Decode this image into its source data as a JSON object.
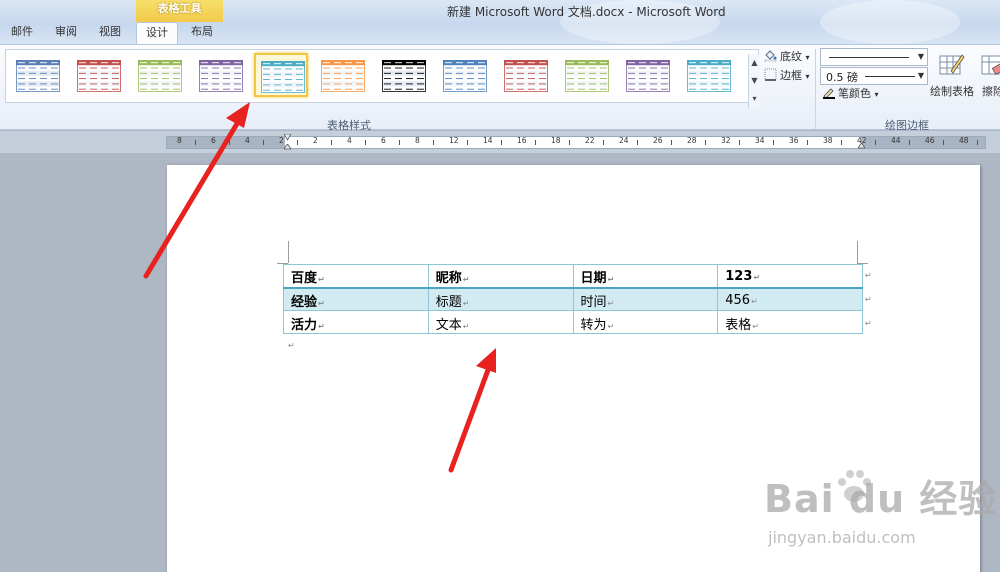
{
  "window": {
    "title": "新建 Microsoft Word 文档.docx  -  Microsoft Word"
  },
  "context_tab_header": "表格工具",
  "tabs": [
    {
      "label": "邮件",
      "active": false
    },
    {
      "label": "审阅",
      "active": false
    },
    {
      "label": "视图",
      "active": false
    },
    {
      "label": "设计",
      "active": true
    },
    {
      "label": "布局",
      "active": false
    }
  ],
  "table_styles": {
    "group_label": "表格样式",
    "selected_index": 4,
    "swatch_colors": [
      "#5b7fb5",
      "#c0504d",
      "#9bbb59",
      "#8064a2",
      "#4bacc6",
      "#f79646",
      "#000000",
      "#4f81bd",
      "#c0504d",
      "#9bbb59",
      "#8064a2",
      "#4bacc6"
    ],
    "shading_label": "底纹",
    "borders_label": "边框"
  },
  "draw_borders": {
    "group_label": "绘图边框",
    "pen_weight": "0.5 磅",
    "pen_color_label": "笔颜色",
    "draw_table_label": "绘制表格",
    "eraser_label": "擦除"
  },
  "ruler": {
    "labels": [
      "8",
      "6",
      "4",
      "2",
      "2",
      "4",
      "6",
      "8",
      "12",
      "14",
      "16",
      "18",
      "22",
      "24",
      "26",
      "28",
      "32",
      "34",
      "36",
      "38",
      "42",
      "44",
      "46",
      "48"
    ]
  },
  "document": {
    "table": {
      "rows": [
        [
          "百度",
          "昵称",
          "日期",
          "123"
        ],
        [
          "经验",
          "标题",
          "时间",
          "456"
        ],
        [
          "活力",
          "文本",
          "转为",
          "表格"
        ]
      ]
    },
    "cell_mark": "↵",
    "paragraph_mark": "↵"
  },
  "watermark": {
    "logo": "Bai du 经验",
    "url": "jingyan.baidu.com"
  },
  "annotation": {
    "arrow_color": "#e8231f"
  }
}
